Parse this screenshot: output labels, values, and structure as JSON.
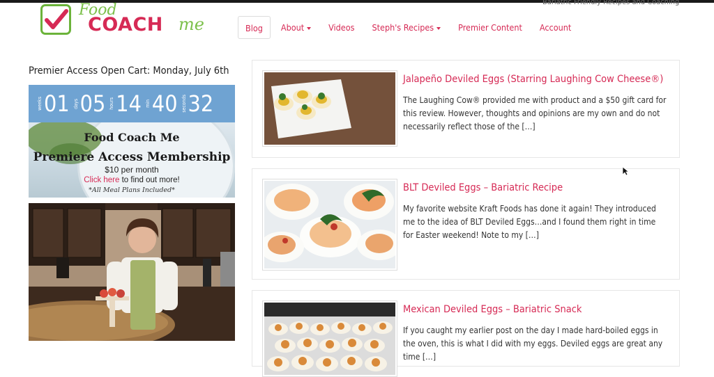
{
  "site": {
    "tagline": "Bariatric Friendly Recipes and Coaching",
    "logo": {
      "word1": "Food",
      "word2": "COACH",
      "word3": "me"
    }
  },
  "nav": {
    "items": [
      {
        "label": "Blog"
      },
      {
        "label": "About"
      },
      {
        "label": "Videos"
      },
      {
        "label": "Steph's Recipes"
      },
      {
        "label": "Premier Content"
      },
      {
        "label": "Account"
      }
    ]
  },
  "sidebar": {
    "title": "Premier Access Open Cart: Monday, July 6th",
    "countdown": {
      "units": [
        {
          "label": "weeks",
          "value": "01"
        },
        {
          "label": "days",
          "value": "05"
        },
        {
          "label": "hours",
          "value": "14"
        },
        {
          "label": "min",
          "value": "40"
        },
        {
          "label": "seconds",
          "value": "32"
        }
      ]
    },
    "promo": {
      "line1": "Food Coach Me",
      "line2": "Premiere Access Membership",
      "price": "$10 per month",
      "cta_link": "Click here",
      "cta_rest": " to find out more!",
      "note": "*All Meal Plans Included*"
    }
  },
  "posts": [
    {
      "title": "Jalapeño Deviled Eggs (Starring Laughing Cow Cheese®)",
      "excerpt": "The Laughing Cow® provided me with product and a $50 gift card for this review. However, thoughts and opinions are my own and do not necessarily reflect those of the […]"
    },
    {
      "title": "BLT Deviled Eggs – Bariatric Recipe",
      "excerpt": "My favorite website Kraft Foods has done it again! They introduced me to the idea of BLT Deviled Eggs…and I found them right in time for Easter weekend! Note to my […]"
    },
    {
      "title": "Mexican Deviled Eggs – Bariatric Snack",
      "excerpt": "If you caught my earlier post on the day I made hard-boiled eggs in the oven, this is what I did with my eggs. Deviled eggs are great any time […]"
    }
  ],
  "colors": {
    "accent": "#d62a55",
    "logo_green": "#7cc04b",
    "countdown_bg": "#6fa3d2"
  }
}
